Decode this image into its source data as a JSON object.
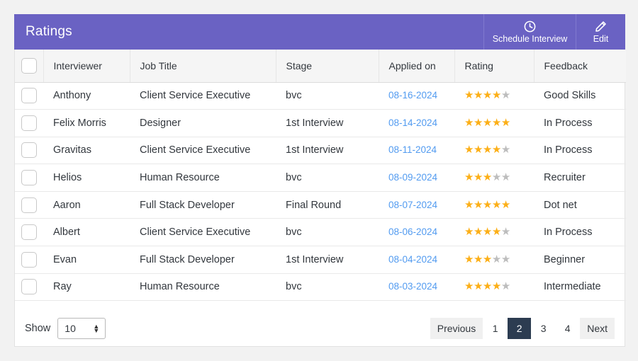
{
  "header": {
    "title": "Ratings",
    "actions": [
      {
        "label": "Schedule Interview",
        "icon": "clock-icon"
      },
      {
        "label": "Edit",
        "icon": "pencil-icon"
      }
    ]
  },
  "table": {
    "columns": [
      "",
      "Interviewer",
      "Job Title",
      "Stage",
      "Applied on",
      "Rating",
      "Feedback"
    ],
    "rows": [
      {
        "interviewer": "Anthony",
        "job_title": "Client Service Executive",
        "stage": "bvc",
        "applied_on": "08-16-2024",
        "rating": 4,
        "feedback": "Good Skills"
      },
      {
        "interviewer": "Felix Morris",
        "job_title": "Designer",
        "stage": "1st Interview",
        "applied_on": "08-14-2024",
        "rating": 5,
        "feedback": "In Process"
      },
      {
        "interviewer": "Gravitas",
        "job_title": "Client Service Executive",
        "stage": "1st Interview",
        "applied_on": "08-11-2024",
        "rating": 4,
        "feedback": "In Process"
      },
      {
        "interviewer": "Helios",
        "job_title": "Human Resource",
        "stage": "bvc",
        "applied_on": "08-09-2024",
        "rating": 3,
        "feedback": "Recruiter"
      },
      {
        "interviewer": "Aaron",
        "job_title": "Full Stack Developer",
        "stage": "Final Round",
        "applied_on": "08-07-2024",
        "rating": 5,
        "feedback": "Dot net"
      },
      {
        "interviewer": "Albert",
        "job_title": "Client Service Executive",
        "stage": "bvc",
        "applied_on": "08-06-2024",
        "rating": 4,
        "feedback": "In Process"
      },
      {
        "interviewer": "Evan",
        "job_title": "Full Stack Developer",
        "stage": "1st Interview",
        "applied_on": "08-04-2024",
        "rating": 3,
        "feedback": "Beginner"
      },
      {
        "interviewer": "Ray",
        "job_title": "Human Resource",
        "stage": "bvc",
        "applied_on": "08-03-2024",
        "rating": 4,
        "feedback": "Intermediate"
      }
    ],
    "max_rating": 5
  },
  "footer": {
    "show_label": "Show",
    "page_size": "10",
    "pagination": {
      "previous_label": "Previous",
      "next_label": "Next",
      "pages": [
        "1",
        "2",
        "3",
        "4"
      ],
      "active_page": "2"
    }
  },
  "colors": {
    "header_purple": "#6a62c3",
    "active_page": "#2c3c51",
    "star_filled": "#fcaf17",
    "star_empty": "#bdbdbd",
    "date_link": "#529bf0",
    "page_background": "#f2f2f2"
  }
}
